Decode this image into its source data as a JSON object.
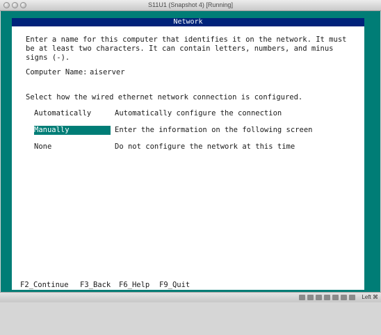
{
  "window": {
    "title": "S11U1 (Snapshot 4) [Running]"
  },
  "dialog": {
    "title": "Network",
    "intro_line1": "Enter a name for this computer that identifies it on the network. It must",
    "intro_line2": "be at least two characters. It can contain letters, numbers, and minus",
    "intro_line3": "signs (-).",
    "computer_name_label": "Computer Name:",
    "computer_name_value": "aiserver",
    "select_prompt": "Select how the wired ethernet network connection is configured.",
    "options": [
      {
        "label": "Automatically",
        "description": "Automatically configure the connection",
        "selected": false
      },
      {
        "label": "Manually",
        "description": "Enter the information on the following screen",
        "selected": true
      },
      {
        "label": "None",
        "description": "Do not configure the network at this time",
        "selected": false
      }
    ]
  },
  "function_keys": [
    {
      "label": "F2_Continue"
    },
    {
      "label": "F3_Back"
    },
    {
      "label": "F6_Help"
    },
    {
      "label": "F9_Quit"
    }
  ],
  "statusbar": {
    "host_key": "Left ⌘"
  },
  "colors": {
    "desktop": "#007d76",
    "title_bar": "#00237a",
    "selection": "#007d76"
  }
}
